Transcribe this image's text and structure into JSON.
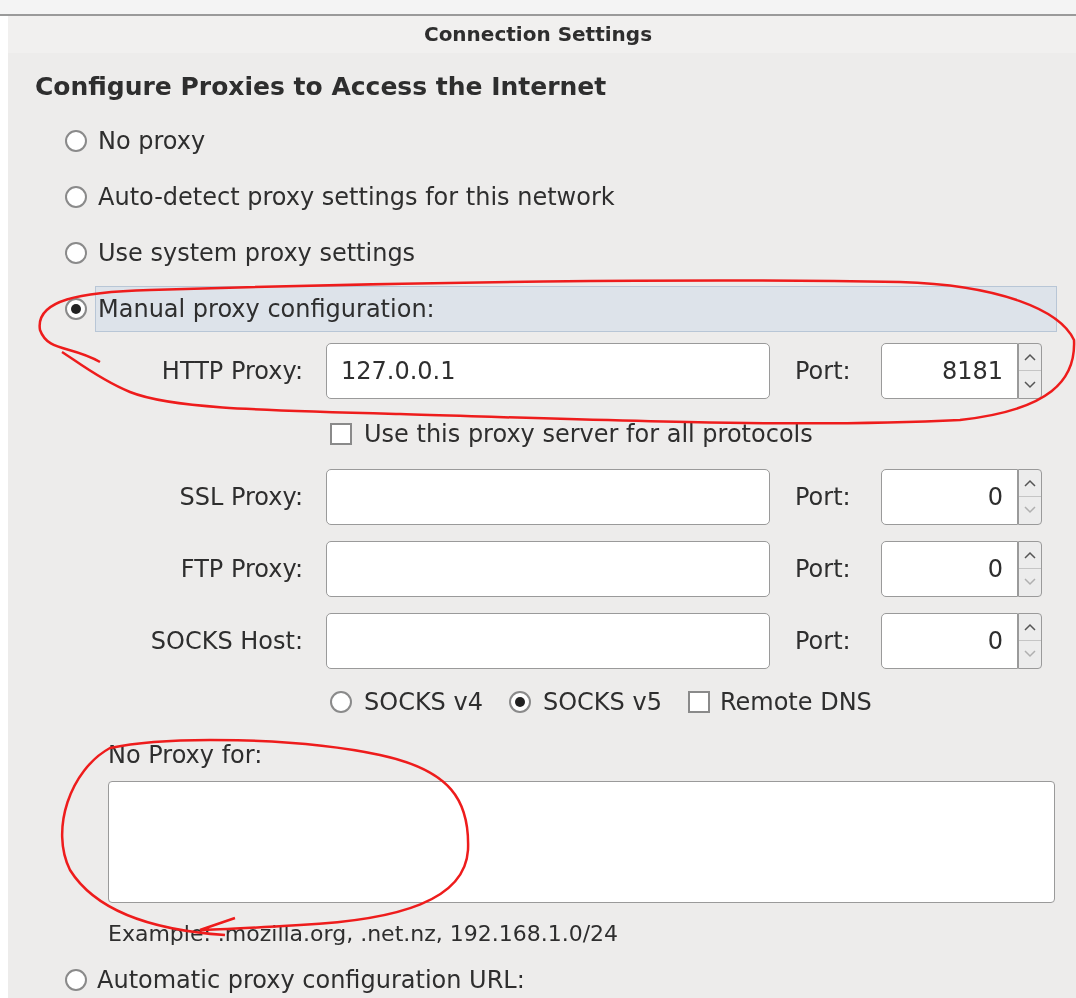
{
  "window": {
    "title": "Connection Settings"
  },
  "heading": "Configure Proxies to Access the Internet",
  "modes": [
    {
      "label": "No proxy",
      "selected": false
    },
    {
      "label": "Auto-detect proxy settings for this network",
      "selected": false
    },
    {
      "label": "Use system proxy settings",
      "selected": false
    },
    {
      "label": "Manual proxy configuration:",
      "selected": true
    }
  ],
  "http_proxy": {
    "label": "HTTP Proxy:",
    "value": "127.0.0.1",
    "port_label": "Port:",
    "port": "8181"
  },
  "share_all": {
    "label": "Use this proxy server for all protocols",
    "checked": false
  },
  "other_proxies": [
    {
      "label": "SSL Proxy:",
      "port_label": "Port:",
      "port": "0"
    },
    {
      "label": "FTP Proxy:",
      "port_label": "Port:",
      "port": "0"
    },
    {
      "label": "SOCKS Host:",
      "port_label": "Port:",
      "port": "0"
    }
  ],
  "socks_versions": [
    {
      "label": "SOCKS v4",
      "selected": false
    },
    {
      "label": "SOCKS v5",
      "selected": true
    }
  ],
  "remote_dns": {
    "label": "Remote DNS",
    "checked": false
  },
  "no_proxy": {
    "label": "No Proxy for:",
    "example": "Example: .mozilla.org, .net.nz, 192.168.1.0/24"
  },
  "auto_config": {
    "label": "Automatic proxy configuration URL:",
    "selected": false
  }
}
